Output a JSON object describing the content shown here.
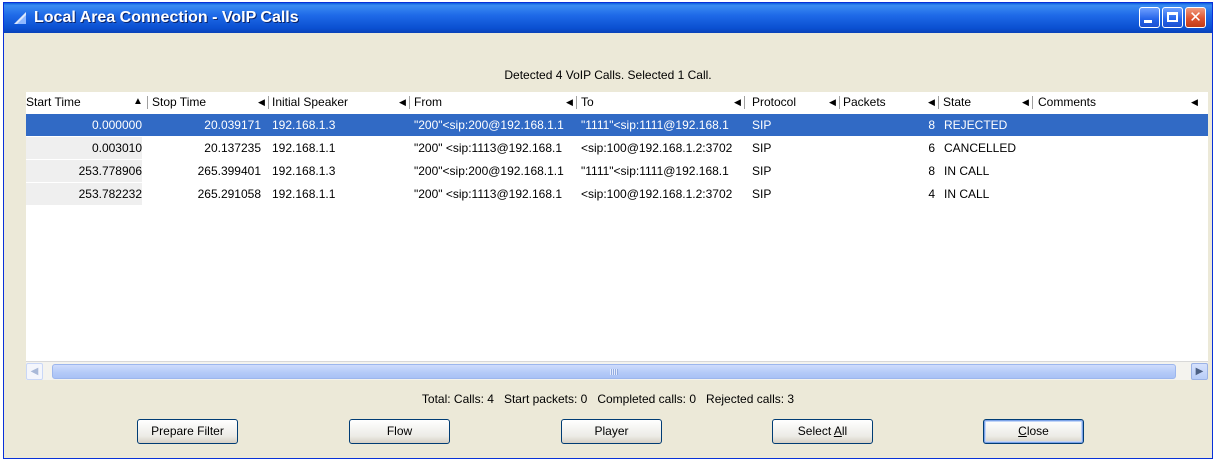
{
  "window": {
    "title": "Local Area Connection - VoIP Calls"
  },
  "status_top": "Detected 4 VoIP Calls. Selected 1 Call.",
  "columns": [
    {
      "label": "Start Time"
    },
    {
      "label": "Stop Time"
    },
    {
      "label": "Initial Speaker"
    },
    {
      "label": "From"
    },
    {
      "label": "To"
    },
    {
      "label": "Protocol"
    },
    {
      "label": "Packets"
    },
    {
      "label": "State"
    },
    {
      "label": "Comments"
    }
  ],
  "rows": [
    {
      "start": "0.000000",
      "stop": "20.039171",
      "speaker": "192.168.1.3",
      "from": "\"200\"<sip:200@192.168.1.1",
      "to": "\"1111\"<sip:1111@192.168.1",
      "protocol": "SIP",
      "packets": "8",
      "state": "REJECTED",
      "comments": "",
      "selected": true
    },
    {
      "start": "0.003010",
      "stop": "20.137235",
      "speaker": "192.168.1.1",
      "from": "\"200\" <sip:1113@192.168.1",
      "to": "<sip:100@192.168.1.2:3702",
      "protocol": "SIP",
      "packets": "6",
      "state": "CANCELLED",
      "comments": "",
      "selected": false
    },
    {
      "start": "253.778906",
      "stop": "265.399401",
      "speaker": "192.168.1.3",
      "from": "\"200\"<sip:200@192.168.1.1",
      "to": "\"1111\"<sip:1111@192.168.1",
      "protocol": "SIP",
      "packets": "8",
      "state": "IN CALL",
      "comments": "",
      "selected": false
    },
    {
      "start": "253.782232",
      "stop": "265.291058",
      "speaker": "192.168.1.1",
      "from": "\"200\" <sip:1113@192.168.1",
      "to": "<sip:100@192.168.1.2:3702",
      "protocol": "SIP",
      "packets": "4",
      "state": "IN CALL",
      "comments": "",
      "selected": false
    }
  ],
  "summary": {
    "text": "Total: Calls: 4   Start packets: 0   Completed calls: 0   Rejected calls: 3"
  },
  "buttons": {
    "prepare_filter": "Prepare Filter",
    "flow": "Flow",
    "player": "Player",
    "select_all_prefix": "Select ",
    "select_all_mnemonic": "A",
    "select_all_suffix": "ll",
    "close_mnemonic": "C",
    "close_suffix": "lose"
  },
  "icons": {
    "window_icon": "voip-window-icon",
    "minimize": "minimize-icon",
    "maximize": "maximize-icon",
    "close": "close-icon",
    "sort_ascending": "sort-ascending-icon",
    "column_menu": "column-left-arrow-icon",
    "scroll_left": "scroll-left-icon",
    "scroll_right": "scroll-right-icon"
  },
  "colors": {
    "selection": "#316ac5",
    "titlebar": "#0a4fd0",
    "close_button": "#de5430"
  }
}
